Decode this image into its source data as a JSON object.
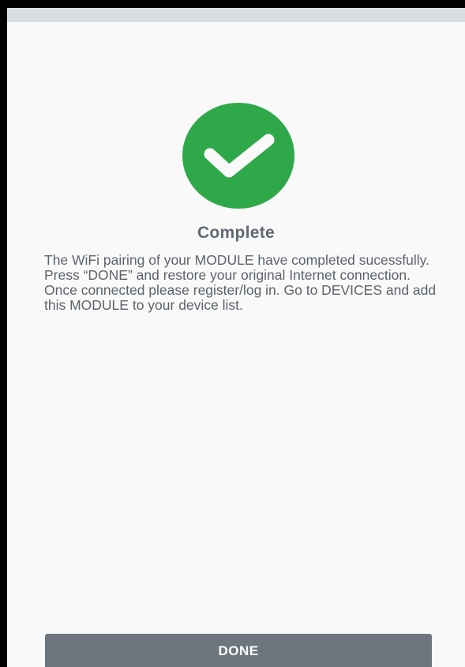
{
  "screen": {
    "title": "Complete",
    "message_lines": [
      "The WiFi pairing of your MODULE have completed sucessfully.",
      "Press “DONE” and restore your original Internet connection.",
      "Once connected please register/log in. Go to DEVICES and add this MODULE to your device list."
    ],
    "status_icon": "check-circle-icon"
  },
  "actions": {
    "done_label": "DONE"
  },
  "colors": {
    "success": "#2fa84a",
    "button": "#6d767e",
    "text": "#5d636b",
    "background": "#f9f9f9"
  }
}
